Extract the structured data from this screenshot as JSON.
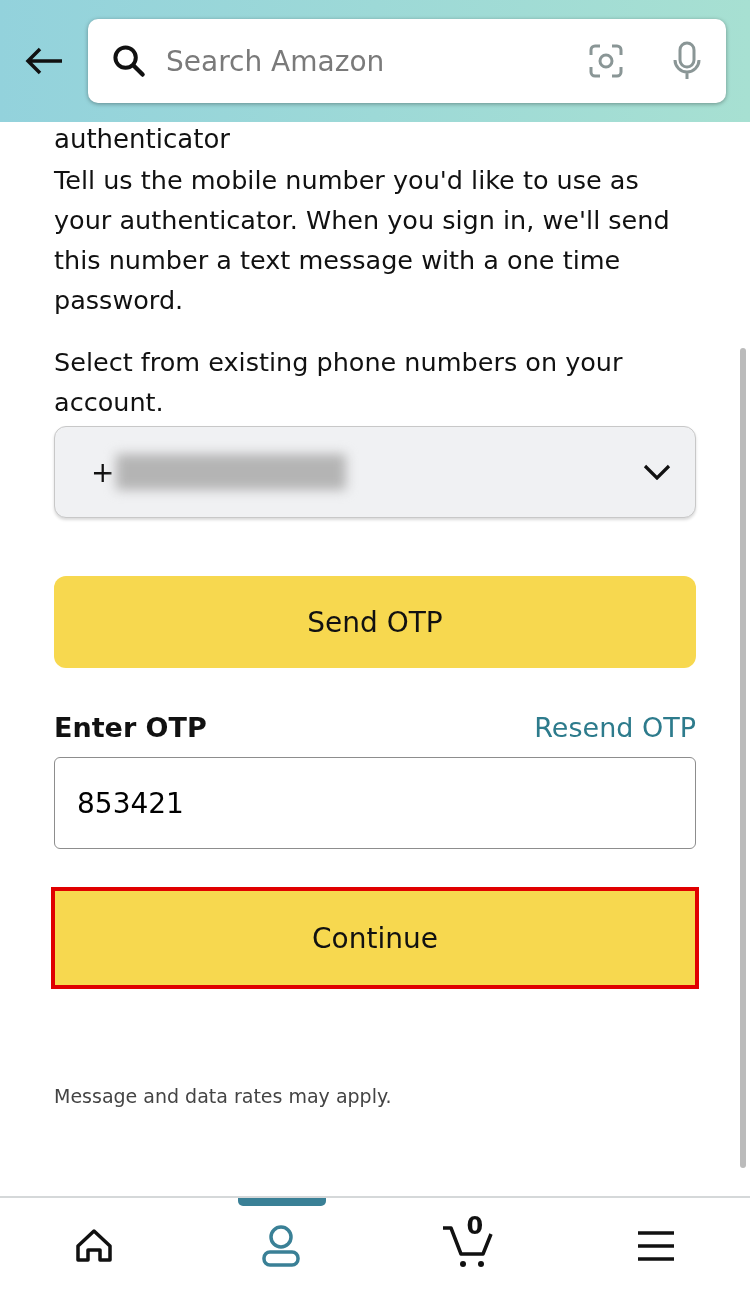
{
  "header": {
    "search": {
      "placeholder": "Search Amazon"
    }
  },
  "content": {
    "heading_fragment": "authenticator",
    "intro": "Tell us the mobile number you'd like to use as your authenticator. When you sign in, we'll send this number a text message with a one time password.",
    "select_label": "Select from existing phone numbers on your account.",
    "phone_select": {
      "value_prefix": "+",
      "redacted": true
    },
    "send_button": "Send OTP",
    "otp_label": "Enter OTP",
    "resend_link": "Resend OTP",
    "otp_field": {
      "value": "853421"
    },
    "continue_button": {
      "label": "Continue",
      "highlighted": true
    },
    "footnote": "Message and data rates may apply."
  },
  "bottom_nav": [
    {
      "kind": "home",
      "selected": false
    },
    {
      "kind": "account",
      "selected": true
    },
    {
      "kind": "cart",
      "selected": false,
      "count": "0"
    },
    {
      "kind": "menu",
      "selected": false
    }
  ]
}
